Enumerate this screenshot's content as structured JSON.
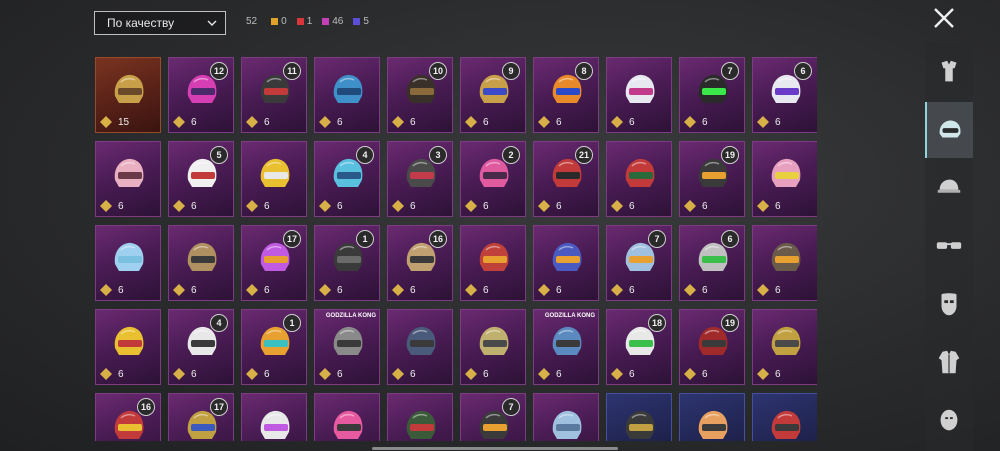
{
  "sort": {
    "label": "По качеству"
  },
  "counts": {
    "total": "52",
    "legendary": {
      "value": "0",
      "color": "#e0a32a"
    },
    "red": {
      "value": "1",
      "color": "#d8363a"
    },
    "purple": {
      "value": "46",
      "color": "#c43fb8"
    },
    "blue": {
      "value": "5",
      "color": "#5a4fd6"
    }
  },
  "close": {
    "icon": "close-icon"
  },
  "items": [
    {
      "points": "15",
      "badge": "",
      "style": "gold",
      "helmet": "#c9a04a",
      "visor": "#6b4a2a"
    },
    {
      "points": "6",
      "badge": "12",
      "style": "purple",
      "helmet": "#d63fb4",
      "visor": "#4a2a6a"
    },
    {
      "points": "6",
      "badge": "11",
      "style": "purple",
      "helmet": "#3a3a3a",
      "visor": "#c33a3a"
    },
    {
      "points": "6",
      "badge": "",
      "style": "purple",
      "helmet": "#3f8fc9",
      "visor": "#1f4a7a"
    },
    {
      "points": "6",
      "badge": "10",
      "style": "purple",
      "helmet": "#3a302a",
      "visor": "#8a6a3a"
    },
    {
      "points": "6",
      "badge": "9",
      "style": "purple",
      "helmet": "#c9a04a",
      "visor": "#3a4ac9"
    },
    {
      "points": "6",
      "badge": "8",
      "style": "purple",
      "helmet": "#e88a2a",
      "visor": "#2a4ac9"
    },
    {
      "points": "6",
      "badge": "",
      "style": "purple",
      "helmet": "#e8e8f0",
      "visor": "#c33a8a"
    },
    {
      "points": "6",
      "badge": "7",
      "style": "purple",
      "helmet": "#2a2a2a",
      "visor": "#3ae84a"
    },
    {
      "points": "6",
      "badge": "6",
      "style": "purple",
      "helmet": "#e8e8f0",
      "visor": "#6a3ac9"
    },
    {
      "points": "6",
      "badge": "",
      "style": "purple",
      "helmet": "#e8b0c0",
      "visor": "#6a3a4a"
    },
    {
      "points": "6",
      "badge": "5",
      "style": "purple",
      "helmet": "#f0f0f0",
      "visor": "#c33a3a"
    },
    {
      "points": "6",
      "badge": "",
      "style": "purple",
      "helmet": "#e8c030",
      "visor": "#e8e8e8"
    },
    {
      "points": "6",
      "badge": "4",
      "style": "purple",
      "helmet": "#5ac0e0",
      "visor": "#2a5a8a"
    },
    {
      "points": "6",
      "badge": "3",
      "style": "purple",
      "helmet": "#4a4a4a",
      "visor": "#c33a4a"
    },
    {
      "points": "6",
      "badge": "2",
      "style": "purple",
      "helmet": "#e05aa0",
      "visor": "#4a2a4a"
    },
    {
      "points": "6",
      "badge": "21",
      "style": "purple",
      "helmet": "#c33a3a",
      "visor": "#2a2a2a"
    },
    {
      "points": "6",
      "badge": "",
      "style": "purple",
      "helmet": "#c33a3a",
      "visor": "#2a6a3a"
    },
    {
      "points": "6",
      "badge": "19",
      "style": "purple",
      "helmet": "#3a3a3a",
      "visor": "#e8a030"
    },
    {
      "points": "6",
      "badge": "",
      "style": "purple",
      "helmet": "#e8a0c0",
      "visor": "#e8d040"
    },
    {
      "points": "6",
      "badge": "",
      "style": "purple",
      "helmet": "#a0d0f0",
      "visor": "#7ac0e0"
    },
    {
      "points": "6",
      "badge": "",
      "style": "purple",
      "helmet": "#b09060",
      "visor": "#3a3a3a"
    },
    {
      "points": "6",
      "badge": "17",
      "style": "purple",
      "helmet": "#c05ae0",
      "visor": "#e8a030"
    },
    {
      "points": "6",
      "badge": "1",
      "style": "purple",
      "helmet": "#3a3a3a",
      "visor": "#6a6a6a"
    },
    {
      "points": "6",
      "badge": "16",
      "style": "purple",
      "helmet": "#c0a070",
      "visor": "#3a3a3a"
    },
    {
      "points": "6",
      "badge": "",
      "style": "purple",
      "helmet": "#c0403a",
      "visor": "#e8a030"
    },
    {
      "points": "6",
      "badge": "",
      "style": "purple",
      "helmet": "#4a5ac0",
      "visor": "#e8a030"
    },
    {
      "points": "6",
      "badge": "7",
      "style": "purple",
      "helmet": "#a0c0e0",
      "visor": "#e8a030"
    },
    {
      "points": "6",
      "badge": "6",
      "style": "purple",
      "helmet": "#c0c0c0",
      "visor": "#3ac04a"
    },
    {
      "points": "6",
      "badge": "",
      "style": "purple",
      "helmet": "#6a5a4a",
      "visor": "#e8a030"
    },
    {
      "points": "6",
      "badge": "",
      "style": "purple",
      "helmet": "#e8c030",
      "visor": "#c33a3a"
    },
    {
      "points": "6",
      "badge": "4",
      "style": "purple",
      "helmet": "#e8e8e8",
      "visor": "#3a3a3a"
    },
    {
      "points": "6",
      "badge": "1",
      "style": "purple",
      "helmet": "#e8a030",
      "visor": "#3ac0c0"
    },
    {
      "points": "6",
      "badge": "",
      "style": "purple",
      "helmet": "#8a8a8a",
      "visor": "#3a3a3a",
      "collab": "GODZILLA KONG"
    },
    {
      "points": "6",
      "badge": "",
      "style": "purple",
      "helmet": "#4a5a7a",
      "visor": "#3a3a3a"
    },
    {
      "points": "6",
      "badge": "",
      "style": "purple",
      "helmet": "#c0b070",
      "visor": "#4a4a4a"
    },
    {
      "points": "6",
      "badge": "",
      "style": "purple",
      "helmet": "#5a8ac0",
      "visor": "#3a3a3a",
      "collab": "GODZILLA KONG"
    },
    {
      "points": "6",
      "badge": "18",
      "style": "purple",
      "helmet": "#e8e8e8",
      "visor": "#3ac04a"
    },
    {
      "points": "6",
      "badge": "19",
      "style": "purple",
      "helmet": "#a02a2a",
      "visor": "#3a3a3a"
    },
    {
      "points": "6",
      "badge": "",
      "style": "purple",
      "helmet": "#c0a040",
      "visor": "#4a4a4a"
    },
    {
      "points": "",
      "badge": "16",
      "style": "purple",
      "helmet": "#c33a3a",
      "visor": "#e8c030"
    },
    {
      "points": "",
      "badge": "17",
      "style": "purple",
      "helmet": "#c0a040",
      "visor": "#3a5ac0"
    },
    {
      "points": "",
      "badge": "",
      "style": "purple",
      "helmet": "#e8e8e8",
      "visor": "#c05ae0"
    },
    {
      "points": "",
      "badge": "",
      "style": "purple",
      "helmet": "#e85aa0",
      "visor": "#3a3a3a"
    },
    {
      "points": "",
      "badge": "",
      "style": "purple",
      "helmet": "#3a5a3a",
      "visor": "#c33a3a"
    },
    {
      "points": "",
      "badge": "7",
      "style": "purple",
      "helmet": "#3a3a3a",
      "visor": "#e8a030"
    },
    {
      "points": "",
      "badge": "",
      "style": "purple",
      "helmet": "#a0c0e0",
      "visor": "#5a7aa0"
    },
    {
      "points": "",
      "badge": "",
      "style": "blue",
      "helmet": "#3a3a3a",
      "visor": "#c0a040"
    },
    {
      "points": "",
      "badge": "",
      "style": "blue",
      "helmet": "#e8a060",
      "visor": "#3a3a3a"
    },
    {
      "points": "",
      "badge": "",
      "style": "blue",
      "helmet": "#c33a3a",
      "visor": "#3a3a3a"
    }
  ],
  "sidebar": [
    {
      "icon": "outfit-icon",
      "active": false
    },
    {
      "icon": "helmet-icon",
      "active": true
    },
    {
      "icon": "cap-icon",
      "active": false
    },
    {
      "icon": "glasses-icon",
      "active": false
    },
    {
      "icon": "mask-icon",
      "active": false
    },
    {
      "icon": "jacket-icon",
      "active": false
    },
    {
      "icon": "face-icon",
      "active": false
    }
  ]
}
